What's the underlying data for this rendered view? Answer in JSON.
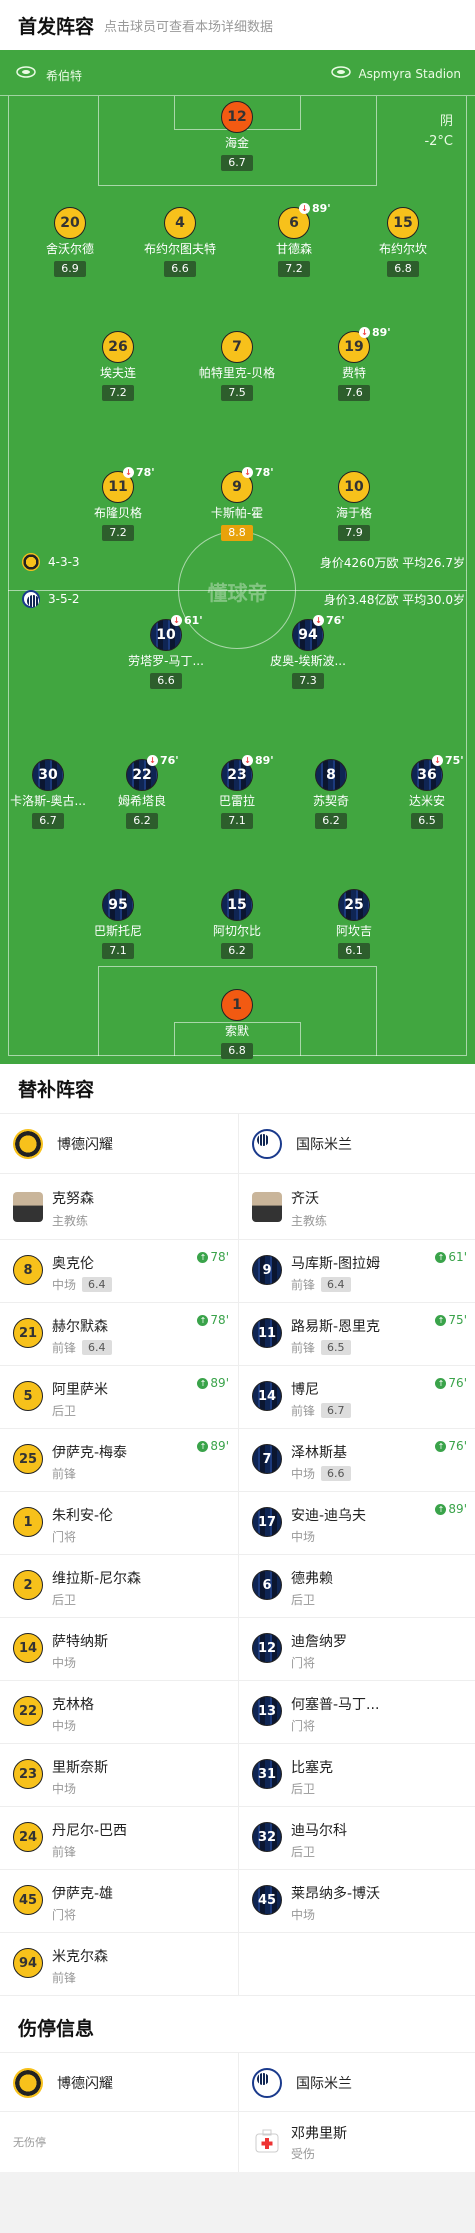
{
  "header": {
    "title": "首发阵容",
    "subtitle": "点击球员可查看本场详细数据"
  },
  "venue": {
    "home": "希伯特",
    "away": "Aspmyra Stadion",
    "weather": "阴",
    "temp": "-2°C"
  },
  "pitch_center": "懂球帝",
  "home_formation": {
    "shape": "4-3-3",
    "value": "身价4260万欧 平均26.7岁"
  },
  "away_formation": {
    "shape": "3-5-2",
    "value": "身价3.48亿欧 平均30.0岁"
  },
  "home_players": [
    {
      "num": "12",
      "name": "海金",
      "rating": "6.7",
      "kit": "keeper"
    },
    {
      "num": "20",
      "name": "舍沃尔德",
      "rating": "6.9",
      "kit": "home"
    },
    {
      "num": "4",
      "name": "布约尔图夫特",
      "rating": "6.6",
      "kit": "home"
    },
    {
      "num": "6",
      "name": "甘德森",
      "rating": "7.2",
      "kit": "home",
      "sub": "89'"
    },
    {
      "num": "15",
      "name": "布约尔坎",
      "rating": "6.8",
      "kit": "home"
    },
    {
      "num": "26",
      "name": "埃夫连",
      "rating": "7.2",
      "kit": "home"
    },
    {
      "num": "7",
      "name": "帕特里克-贝格",
      "rating": "7.5",
      "kit": "home"
    },
    {
      "num": "19",
      "name": "费特",
      "rating": "7.6",
      "kit": "home",
      "sub": "89'"
    },
    {
      "num": "11",
      "name": "布隆贝格",
      "rating": "7.2",
      "kit": "home",
      "sub": "78'"
    },
    {
      "num": "9",
      "name": "卡斯帕-霍",
      "rating": "8.8",
      "kit": "home",
      "sub": "78'"
    },
    {
      "num": "10",
      "name": "海于格",
      "rating": "7.9",
      "kit": "home"
    }
  ],
  "away_players": [
    {
      "num": "10",
      "name": "劳塔罗-马丁...",
      "rating": "6.6",
      "kit": "away",
      "sub": "61'"
    },
    {
      "num": "94",
      "name": "皮奥-埃斯波...",
      "rating": "7.3",
      "kit": "away",
      "sub": "76'"
    },
    {
      "num": "30",
      "name": "卡洛斯-奥古...",
      "rating": "6.7",
      "kit": "away"
    },
    {
      "num": "22",
      "name": "姆希塔良",
      "rating": "6.2",
      "kit": "away",
      "sub": "76'"
    },
    {
      "num": "23",
      "name": "巴雷拉",
      "rating": "7.1",
      "kit": "away",
      "sub": "89'"
    },
    {
      "num": "8",
      "name": "苏契奇",
      "rating": "6.2",
      "kit": "away"
    },
    {
      "num": "36",
      "name": "达米安",
      "rating": "6.5",
      "kit": "away",
      "sub": "75'"
    },
    {
      "num": "95",
      "name": "巴斯托尼",
      "rating": "7.1",
      "kit": "away"
    },
    {
      "num": "15",
      "name": "阿切尔比",
      "rating": "6.2",
      "kit": "away"
    },
    {
      "num": "25",
      "name": "阿坎吉",
      "rating": "6.1",
      "kit": "away"
    },
    {
      "num": "1",
      "name": "索默",
      "rating": "6.8",
      "kit": "keeper"
    }
  ],
  "subs": {
    "title": "替补阵容",
    "home_team": "博德闪耀",
    "away_team": "国际米兰",
    "home_coach": {
      "name": "克努森",
      "role": "主教练"
    },
    "away_coach": {
      "name": "齐沃",
      "role": "主教练"
    },
    "rows": [
      [
        {
          "num": "8",
          "name": "奥克伦",
          "pos": "中场",
          "rating": "6.4",
          "in": "78'"
        },
        {
          "num": "9",
          "name": "马库斯-图拉姆",
          "pos": "前锋",
          "rating": "6.4",
          "in": "61'"
        }
      ],
      [
        {
          "num": "21",
          "name": "赫尔默森",
          "pos": "前锋",
          "rating": "6.4",
          "in": "78'"
        },
        {
          "num": "11",
          "name": "路易斯-恩里克",
          "pos": "前锋",
          "rating": "6.5",
          "in": "75'"
        }
      ],
      [
        {
          "num": "5",
          "name": "阿里萨米",
          "pos": "后卫",
          "rating": "",
          "in": "89'"
        },
        {
          "num": "14",
          "name": "博尼",
          "pos": "前锋",
          "rating": "6.7",
          "in": "76'"
        }
      ],
      [
        {
          "num": "25",
          "name": "伊萨克-梅泰",
          "pos": "前锋",
          "rating": "",
          "in": "89'"
        },
        {
          "num": "7",
          "name": "泽林斯基",
          "pos": "中场",
          "rating": "6.6",
          "in": "76'"
        }
      ],
      [
        {
          "num": "1",
          "name": "朱利安-伦",
          "pos": "门将",
          "rating": "",
          "in": ""
        },
        {
          "num": "17",
          "name": "安迪-迪乌夫",
          "pos": "中场",
          "rating": "",
          "in": "89'"
        }
      ],
      [
        {
          "num": "2",
          "name": "维拉斯-尼尔森",
          "pos": "后卫",
          "rating": "",
          "in": ""
        },
        {
          "num": "6",
          "name": "德弗赖",
          "pos": "后卫",
          "rating": "",
          "in": ""
        }
      ],
      [
        {
          "num": "14",
          "name": "萨特纳斯",
          "pos": "中场",
          "rating": "",
          "in": ""
        },
        {
          "num": "12",
          "name": "迪詹纳罗",
          "pos": "门将",
          "rating": "",
          "in": ""
        }
      ],
      [
        {
          "num": "22",
          "name": "克林格",
          "pos": "中场",
          "rating": "",
          "in": ""
        },
        {
          "num": "13",
          "name": "何塞普-马丁...",
          "pos": "门将",
          "rating": "",
          "in": ""
        }
      ],
      [
        {
          "num": "23",
          "name": "里斯奈斯",
          "pos": "中场",
          "rating": "",
          "in": ""
        },
        {
          "num": "31",
          "name": "比塞克",
          "pos": "后卫",
          "rating": "",
          "in": ""
        }
      ],
      [
        {
          "num": "24",
          "name": "丹尼尔-巴西",
          "pos": "前锋",
          "rating": "",
          "in": ""
        },
        {
          "num": "32",
          "name": "迪马尔科",
          "pos": "后卫",
          "rating": "",
          "in": ""
        }
      ],
      [
        {
          "num": "45",
          "name": "伊萨克-雄",
          "pos": "门将",
          "rating": "",
          "in": ""
        },
        {
          "num": "45",
          "name": "莱昂纳多-博沃",
          "pos": "中场",
          "rating": "",
          "in": ""
        }
      ],
      [
        {
          "num": "94",
          "name": "米克尔森",
          "pos": "前锋",
          "rating": "",
          "in": ""
        },
        null
      ]
    ]
  },
  "injuries": {
    "title": "伤停信息",
    "home_team": "博德闪耀",
    "away_team": "国际米兰",
    "home_none": "无伤停",
    "away_player": {
      "name": "邓弗里斯",
      "status": "受伤"
    }
  }
}
